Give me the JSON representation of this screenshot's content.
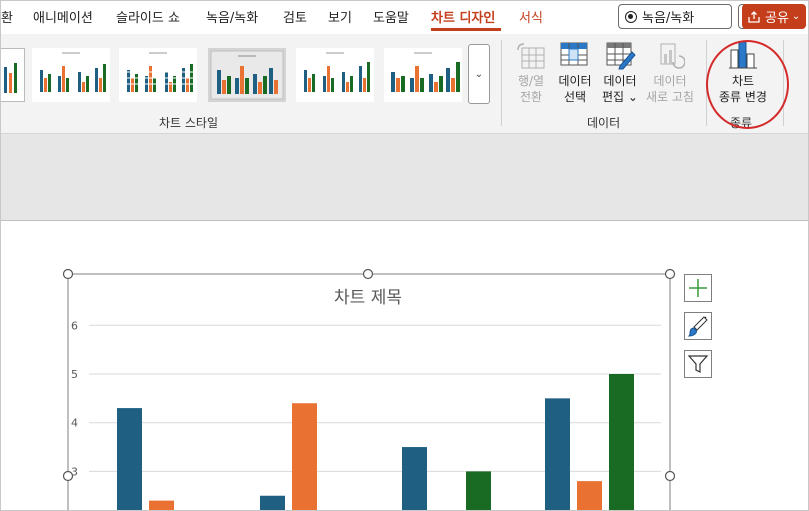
{
  "menu": {
    "items": [
      "환",
      "애니메이션",
      "슬라이드 쇼",
      "녹음/녹화",
      "검토",
      "보기",
      "도움말",
      "차트 디자인",
      "서식"
    ],
    "active_tab": "차트 디자인",
    "record_label": "녹음/녹화",
    "share_label": "공유"
  },
  "ribbon": {
    "chart_styles_label": "차트 스타일",
    "data_group_label": "데이터",
    "type_group_label": "종류",
    "buttons": {
      "switch_row_col": [
        "행/열",
        "전환"
      ],
      "select_data": [
        "데이터",
        "선택"
      ],
      "edit_data": [
        "데이터",
        "편집 ⌄"
      ],
      "refresh_data": [
        "데이터",
        "새로 고침"
      ],
      "change_chart_type": [
        "차트",
        "종류 변경"
      ]
    }
  },
  "chart": {
    "title": "차트 제목"
  },
  "chart_data": {
    "type": "bar",
    "title": "차트 제목",
    "ylim": [
      0,
      6
    ],
    "yticks": [
      3,
      4,
      5,
      6
    ],
    "grid": true,
    "categories": [
      "",
      "",
      "",
      ""
    ],
    "series": [
      {
        "values": [
          4.3,
          2.5,
          3.5,
          4.5
        ],
        "color": "#1f5f82"
      },
      {
        "values": [
          2.4,
          4.4,
          1.8,
          2.8
        ],
        "color": "#e97132"
      },
      {
        "values": [
          2.0,
          2.0,
          3.0,
          5.0
        ],
        "color": "#196b24"
      }
    ]
  },
  "colors": {
    "accent": "#c43e1c",
    "highlight_circle": "#d42a2a",
    "series1": "#1f5f82",
    "series2": "#e97132",
    "series3": "#196b24"
  }
}
